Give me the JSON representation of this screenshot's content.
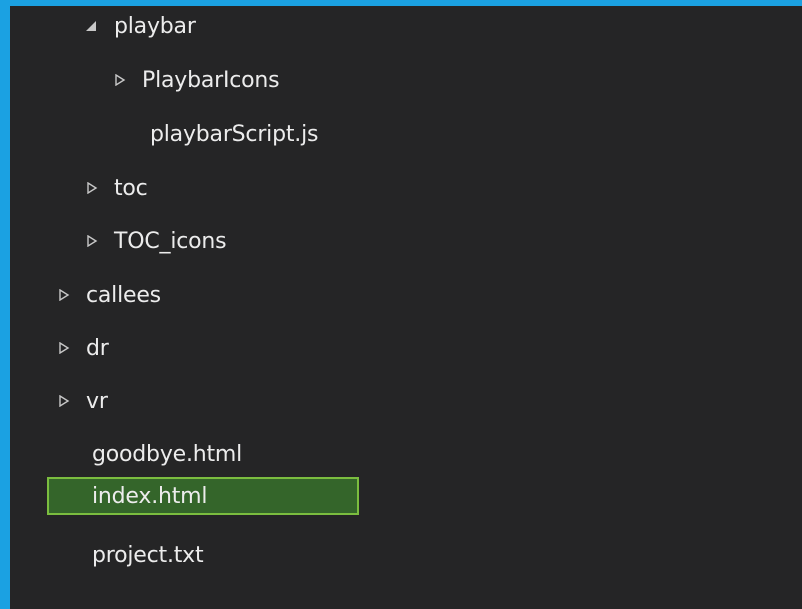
{
  "explorer": {
    "items": [
      {
        "label": "playbar",
        "kind": "folder",
        "state": "expanded",
        "depth": 2
      },
      {
        "label": "PlaybarIcons",
        "kind": "folder",
        "state": "collapsed",
        "depth": 3
      },
      {
        "label": "playbarScript.js",
        "kind": "file",
        "depth": 3
      },
      {
        "label": "toc",
        "kind": "folder",
        "state": "collapsed",
        "depth": 2
      },
      {
        "label": "TOC_icons",
        "kind": "folder",
        "state": "collapsed",
        "depth": 2
      },
      {
        "label": "callees",
        "kind": "folder",
        "state": "collapsed",
        "depth": 1
      },
      {
        "label": "dr",
        "kind": "folder",
        "state": "collapsed",
        "depth": 1
      },
      {
        "label": "vr",
        "kind": "folder",
        "state": "collapsed",
        "depth": 1
      },
      {
        "label": "goodbye.html",
        "kind": "file",
        "depth": 1
      },
      {
        "label": "index.html",
        "kind": "file",
        "depth": 1,
        "selected": true
      },
      {
        "label": "project.txt",
        "kind": "file",
        "depth": 1
      }
    ]
  },
  "colors": {
    "outer_accent": "#1ba1e2",
    "panel_background": "#252526",
    "text": "#ececec",
    "selection_fill": "#34652a",
    "selection_border": "#7bbd3f"
  }
}
